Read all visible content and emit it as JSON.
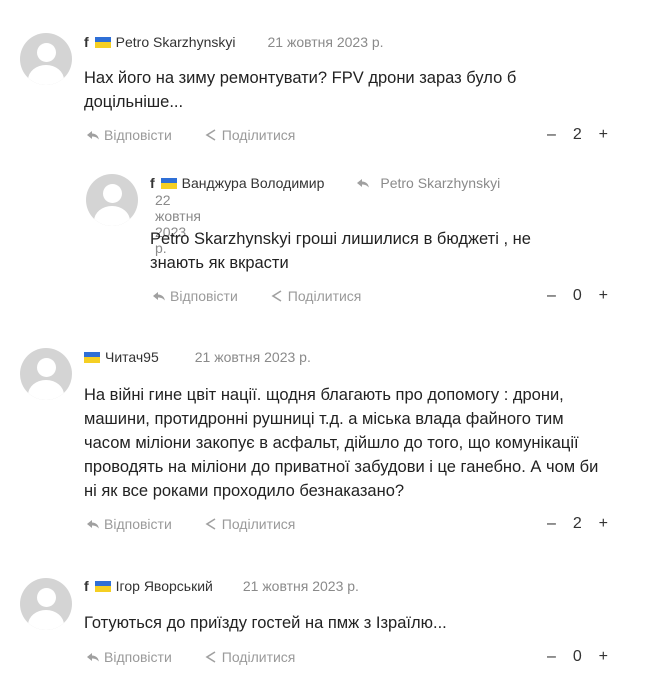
{
  "actions": {
    "reply_label": "Відповісти",
    "share_label": "Поділитися"
  },
  "comments": [
    {
      "author": "Petro Skarzhynskyi",
      "date": "21 жовтня 2023 р.",
      "text": "Нах його на зиму ремонтувати? FPV дрони зараз було б доцільніше...",
      "vote_minus": "–",
      "vote_count": "2",
      "vote_plus": "+"
    },
    {
      "author": "Ванджура Володимир",
      "reply_to": "Petro Skarzhynskyi",
      "date": "22 жовтня 2023 р.",
      "text": "Petro Skarzhynskyi гроші лишилися в бюджеті , не знають як вкрасти",
      "vote_minus": "–",
      "vote_count": "0",
      "vote_plus": "+"
    },
    {
      "author": "Читач95",
      "date": "21 жовтня 2023 р.",
      "text": "На війні гине цвіт нації. щодня благають про допомогу : дрони, машини, протидронні рушниці т.д. а міська влада файного тим часом міліони закопує в асфальт, дійшло до того, що комунікації проводять на міліони до приватної забудови і це ганебно. А чом би ні як все роками проходило безнаказано?",
      "vote_minus": "–",
      "vote_count": "2",
      "vote_plus": "+"
    },
    {
      "author": "Ігор Яворський",
      "date": "21 жовтня 2023 р.",
      "text": "Готуються до приїзду гостей на пмж з Ізраїлю...",
      "vote_minus": "–",
      "vote_count": "0",
      "vote_plus": "+"
    }
  ]
}
